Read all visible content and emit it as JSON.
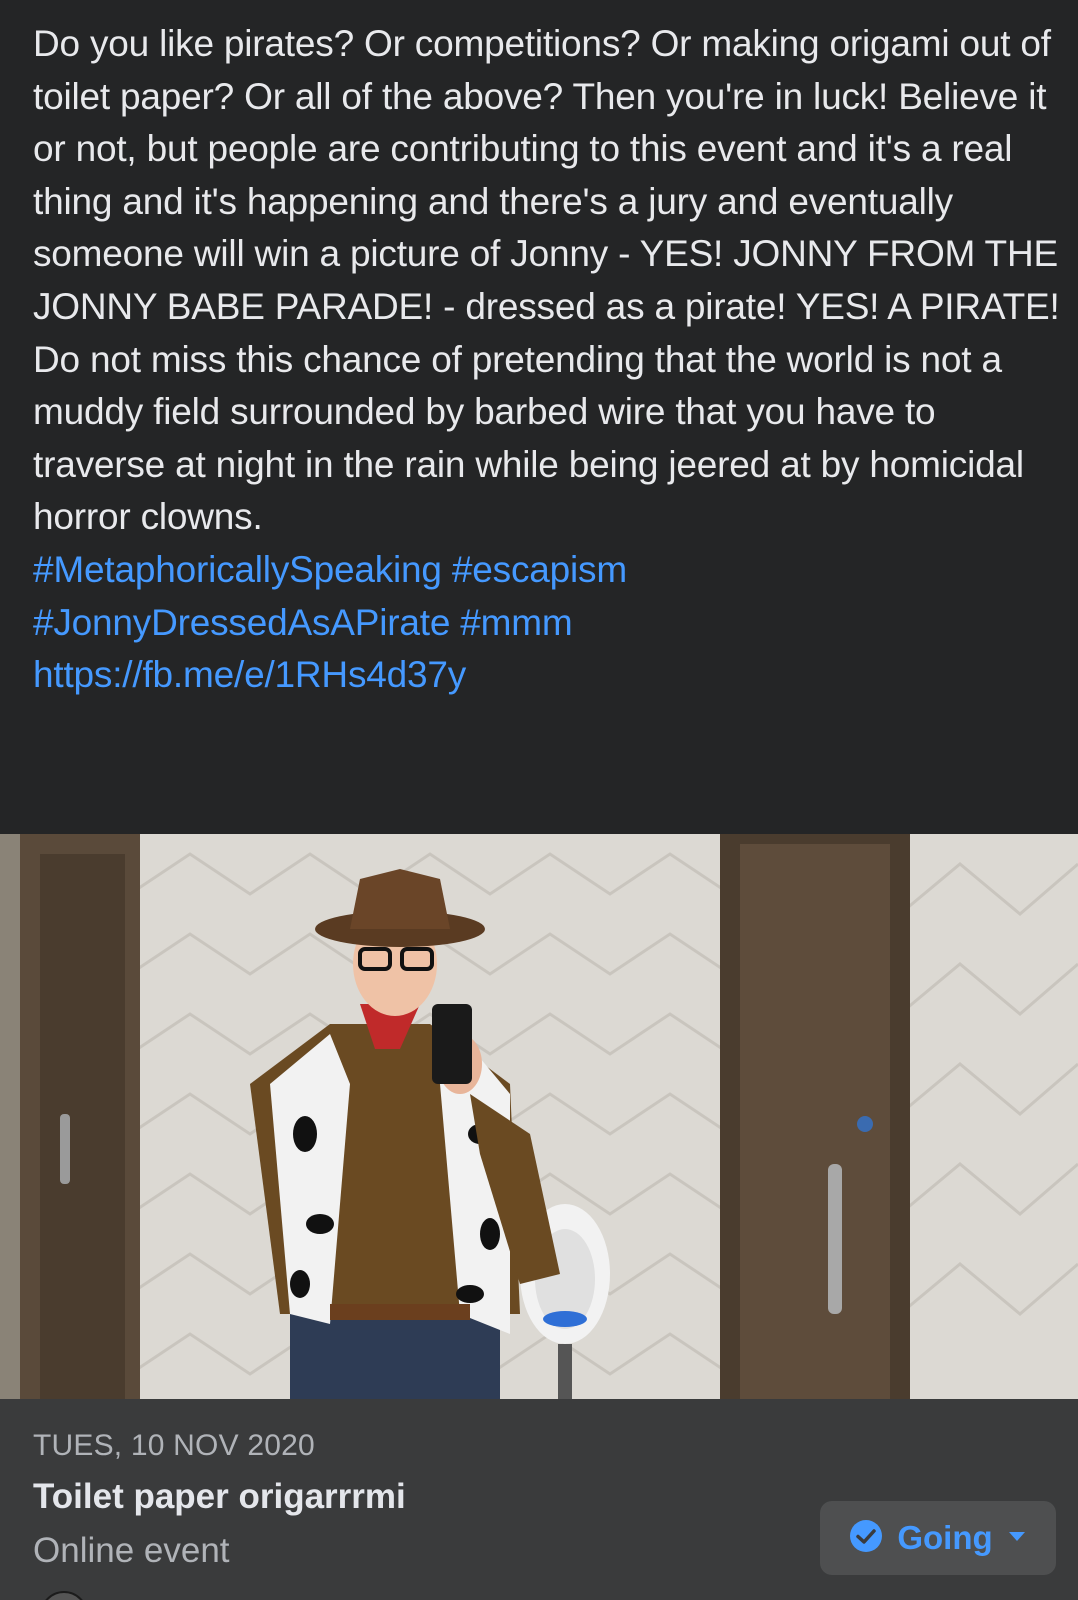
{
  "post": {
    "paragraph1": "Do you like pirates? Or competitions? Or making origami out of toilet paper? Or all of the above? Then you're in luck! Believe it or not, but people are contributing to this event and it's a real thing and it's happening and there's a jury and eventually someone will win a picture of Jonny - YES! JONNY FROM THE JONNY BABE PARADE! - dressed as a pirate! YES! A PIRATE!",
    "paragraph2": "Do not miss this chance of pretending that the world is not a muddy field surrounded by barbed wire that you have to traverse at night in the rain while being jeered at by homicidal horror clowns.",
    "hashtags": [
      "#MetaphoricallySpeaking",
      "#escapism",
      "#JonnyDressedAsAPirate",
      "#mmm"
    ],
    "link": "https://fb.me/e/1RHs4d37y"
  },
  "event": {
    "date": "TUES, 10 NOV 2020",
    "title": "Toilet paper origarrrmi",
    "type": "Online event",
    "rsvp_label": "Going"
  },
  "colors": {
    "background": "#242526",
    "link": "#4599ff",
    "card": "#3a3b3c",
    "button": "#4e4f50"
  },
  "icons": {
    "rsvp_status": "check-circle-icon",
    "rsvp_menu": "caret-down-icon"
  }
}
